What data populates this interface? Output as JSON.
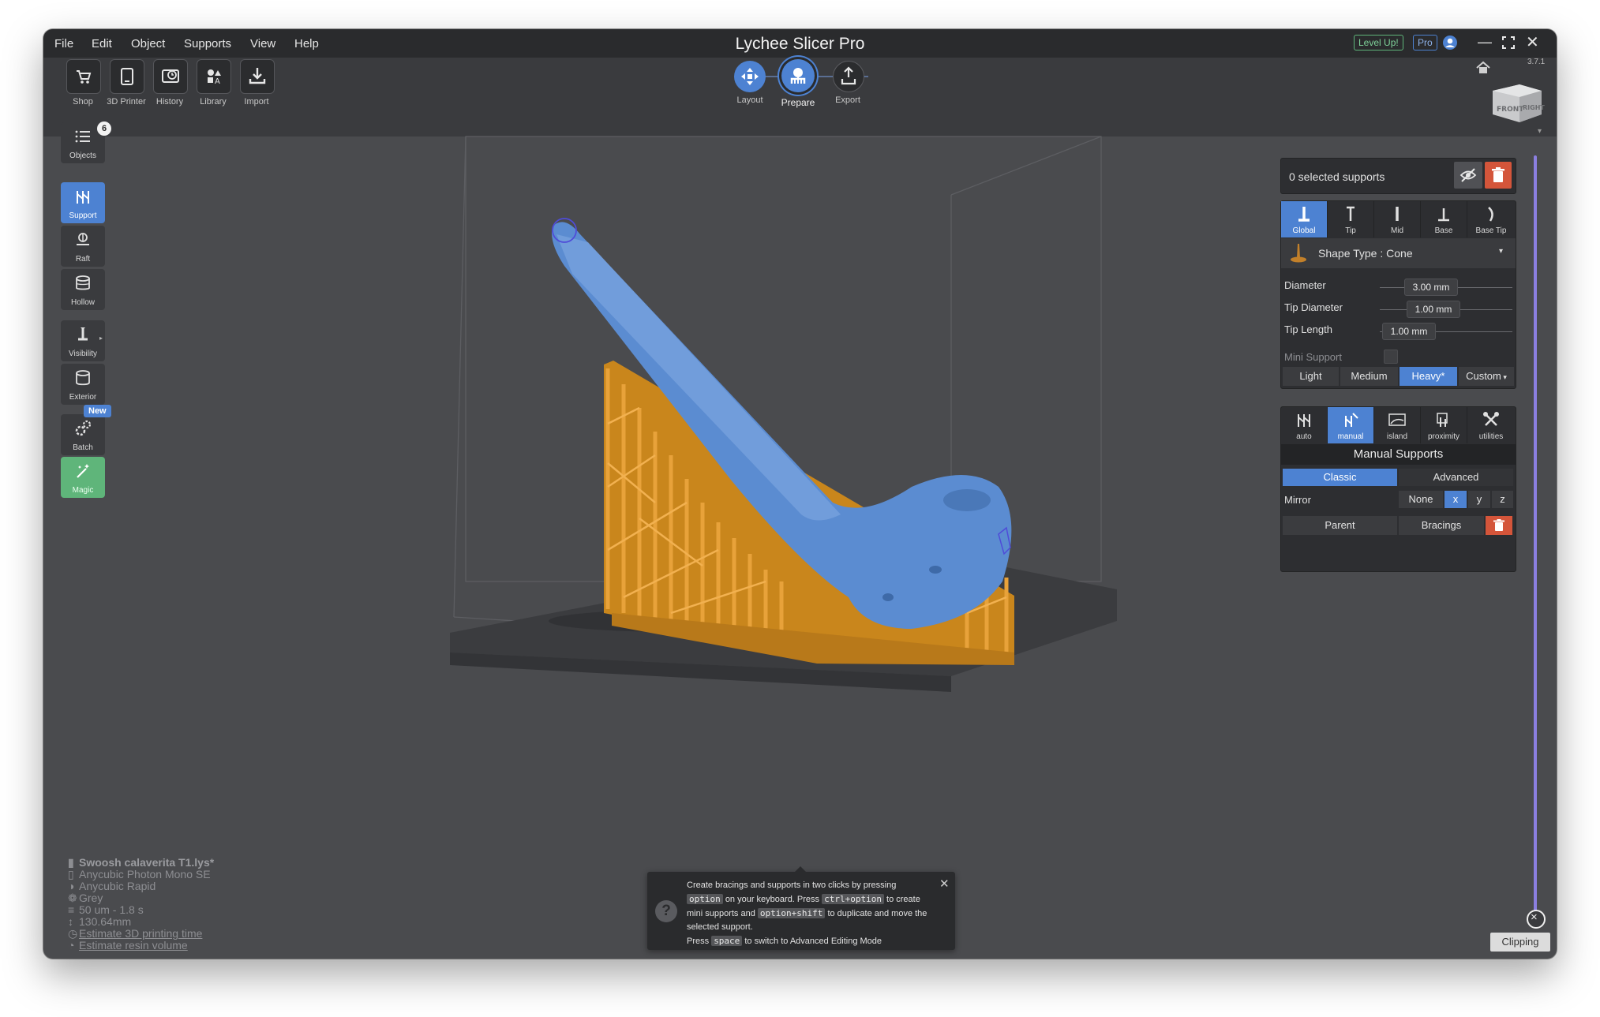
{
  "window": {
    "title": "Lychee Slicer Pro",
    "version": "3.7.1",
    "badges": {
      "level_up": "Level Up!",
      "pro": "Pro"
    }
  },
  "menu": [
    "File",
    "Edit",
    "Object",
    "Supports",
    "View",
    "Help"
  ],
  "toolbar": {
    "tools": [
      "Shop",
      "3D Printer",
      "History",
      "Library",
      "Import"
    ],
    "steps": [
      "Layout",
      "Prepare",
      "Export"
    ],
    "active_step": "Prepare"
  },
  "sidebar": {
    "objects_label": "Objects",
    "objects_count": "6",
    "items": [
      "Support",
      "Raft",
      "Hollow",
      "Visibility",
      "Exterior",
      "Batch",
      "Magic"
    ],
    "batch_badge": "New"
  },
  "selection_panel": {
    "title": "0 selected supports",
    "tabs": [
      "Global",
      "Tip",
      "Mid",
      "Base",
      "Base Tip"
    ],
    "shape_type": "Shape Type : Cone",
    "diameter_label": "Diameter",
    "diameter_value": "3.00 mm",
    "tip_diameter_label": "Tip Diameter",
    "tip_diameter_value": "1.00 mm",
    "tip_length_label": "Tip Length",
    "tip_length_value": "1.00 mm",
    "mini_support_label": "Mini Support",
    "presets": [
      "Light",
      "Medium",
      "Heavy*",
      "Custom"
    ],
    "active_preset": "Heavy*"
  },
  "manual_panel": {
    "tabs": [
      "auto",
      "manual",
      "island",
      "proximity",
      "utilities"
    ],
    "title": "Manual Supports",
    "modes": [
      "Classic",
      "Advanced"
    ],
    "mirror_label": "Mirror",
    "mirror_options": [
      "None",
      "x",
      "y",
      "z"
    ],
    "parent_label": "Parent",
    "bracings_label": "Bracings"
  },
  "info": {
    "file": "Swoosh calaverita T1.lys*",
    "printer": "Anycubic Photon Mono SE",
    "resin": "Anycubic Rapid",
    "color": "Grey",
    "layer": "50 um - 1.8 s",
    "height": "130.64mm",
    "estimate_time": "Estimate 3D printing time",
    "estimate_volume": "Estimate resin volume"
  },
  "tip": {
    "line1": "Create bracings and supports in two clicks by pressing",
    "k_option": "option",
    "t2": "on your keyboard. Press",
    "k_ctrl": "ctrl+option",
    "t3": "to create",
    "t4": "mini supports and",
    "k_shift": "option+shift",
    "t5": "to duplicate and move the",
    "t6": "selected support.",
    "t7": "Press",
    "k_space": "space",
    "t8": "to switch to Advanced Editing Mode"
  },
  "viewcube": {
    "front": "FRONT",
    "right": "RIGHT"
  },
  "clipping_label": "Clipping",
  "colors": {
    "accent": "#4d82d2",
    "model": "#5b8cd1",
    "supports": "#d99220",
    "delete": "#d4553a",
    "magic": "#5fb57a"
  }
}
